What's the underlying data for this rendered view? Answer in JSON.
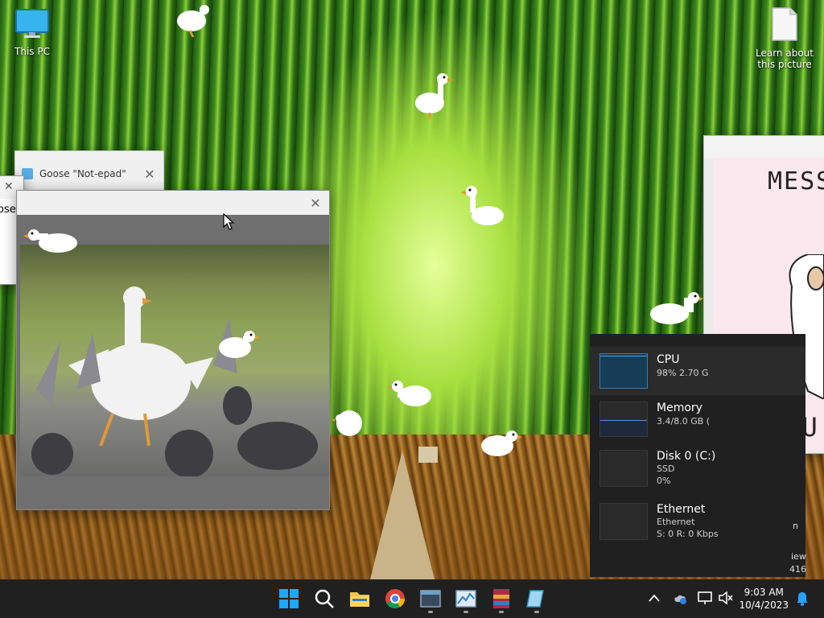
{
  "desktop": {
    "icons": [
      {
        "label": "This PC"
      },
      {
        "label": "Learn about this picture"
      }
    ]
  },
  "windows": {
    "notepad_back": {
      "title": "Goose \"Not-epad\""
    },
    "notepad_front": {
      "text": "ose"
    },
    "poster": {
      "text_top": "MESS V",
      "text_bottom": "YOU G"
    }
  },
  "task_manager": {
    "rows": [
      {
        "name": "CPU",
        "detail1": "98% 2.70 G"
      },
      {
        "name": "Memory",
        "detail1": "3.4/8.0 GB ("
      },
      {
        "name": "Disk 0 (C:)",
        "detail1": "SSD",
        "detail2": "0%"
      },
      {
        "name": "Ethernet",
        "detail1": "Ethernet",
        "detail2": "S: 0 R: 0 Kbps"
      }
    ],
    "edge_text": [
      "n",
      "iew",
      "416"
    ]
  },
  "taskbar": {
    "time": "9:03 AM",
    "date": "10/4/2023"
  },
  "colors": {
    "taskbar_bg": "#202020",
    "accent": "#0a84ff",
    "cpu_graph": "#1d6fa8"
  }
}
